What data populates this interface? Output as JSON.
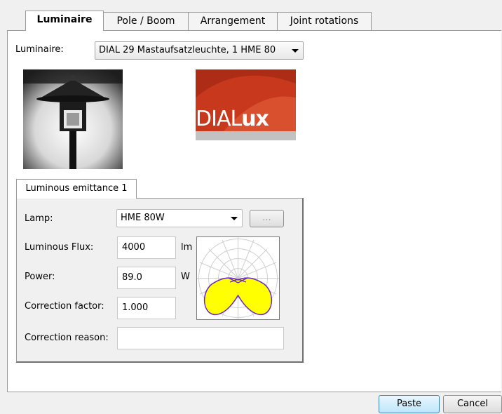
{
  "tabs": [
    "Luminaire",
    "Pole / Boom",
    "Arrangement",
    "Joint rotations"
  ],
  "luminaire": {
    "label": "Luminaire:",
    "selected": "DIAL 29 Mastaufsatzleuchte, 1 HME 80"
  },
  "logo": {
    "text_light": "DIAL",
    "text_bold": "ux"
  },
  "emittance_tab": "Luminous emittance 1",
  "lamp": {
    "label": "Lamp:",
    "selected": "HME 80W",
    "browse_label": "..."
  },
  "flux": {
    "label": "Luminous Flux:",
    "value": "4000",
    "unit": "lm"
  },
  "power": {
    "label": "Power:",
    "value": "89.0",
    "unit": "W"
  },
  "correction_factor": {
    "label": "Correction factor:",
    "value": "1.000"
  },
  "correction_reason": {
    "label": "Correction reason:",
    "value": ""
  },
  "buttons": {
    "paste": "Paste",
    "cancel": "Cancel"
  },
  "colors": {
    "brand_red": "#c8381d",
    "ldc_fill": "#ffff00",
    "ldc_line": "#6a24c8"
  }
}
